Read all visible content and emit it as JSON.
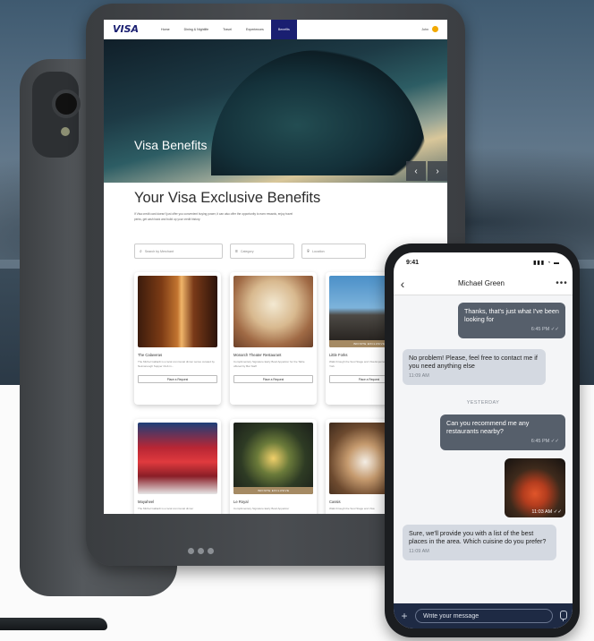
{
  "tablet": {
    "logo": "VISA",
    "nav": [
      "Home",
      "Dining & Nightlife",
      "Travel",
      "Experiences",
      "Benefits"
    ],
    "active_nav": "Benefits",
    "user": "John",
    "hero_title": "Visa Benefits",
    "hero_prev": "‹",
    "hero_next": "›",
    "section_title": "Your Visa Exclusive Benefits",
    "intro": "If Visa credit card doesn't just offer you convenient buying power, it can also offer the opportunity to earn rewards, enjoy travel perks, get cash back and build up your credit history.",
    "filters": {
      "search_placeholder": "Search by Merchant",
      "category": "Category",
      "location": "Location"
    },
    "cards": [
      {
        "name": "The Calaveras",
        "desc": "The Michel Gallardi is a local communal dinner series curated by Neimanough Supper Club in...",
        "button": "Place a Request",
        "badge": ""
      },
      {
        "name": "Monarch Theater Restaurant",
        "desc": "Complimentary Signature Early Bowl Appetizer for the Table offered by Bar Staff",
        "button": "Place a Request",
        "badge": ""
      },
      {
        "name": "Little Forks",
        "desc": "Walk through the Soul Stage and Visa Experiences Hotel in New York",
        "button": "Place a Request",
        "badge": "INFINITE EXCLUSIVE"
      },
      {
        "name": "Mayaheel",
        "desc": "The Michel Gallardi is a local communal dinner",
        "button": "",
        "badge": ""
      },
      {
        "name": "Le Royal",
        "desc": "Complimentary Signature Early Bowl Appetizer",
        "button": "",
        "badge": "INFINITE EXCLUSIVE"
      },
      {
        "name": "Cassis",
        "desc": "Walk through the Soul Stage and Visa",
        "button": "",
        "badge": ""
      }
    ]
  },
  "phone": {
    "time": "9:41",
    "status_icons": "▮▮▮ ◔ ▬",
    "contact": "Michael Green",
    "more": "•••",
    "back": "‹",
    "messages": [
      {
        "dir": "out",
        "text": "Thanks, that's just what I've been looking for",
        "time": "6:45 PM ✓✓"
      },
      {
        "dir": "in",
        "text": "No problem! Please, feel free to contact me if you need anything else",
        "time": "11:09 AM"
      },
      {
        "dir": "sep",
        "text": "YESTERDAY"
      },
      {
        "dir": "out",
        "text": "Can you recommend me any restaurants nearby?",
        "time": "6:45 PM ✓✓"
      },
      {
        "dir": "photo",
        "time": "11:03 AM ✓✓"
      },
      {
        "dir": "in",
        "text": "Sure, we'll provide you with a list of the best places in the area. Which cuisine do you prefer?",
        "time": "11:09 AM"
      }
    ],
    "composer_placeholder": "Write your message",
    "plus": "+"
  }
}
